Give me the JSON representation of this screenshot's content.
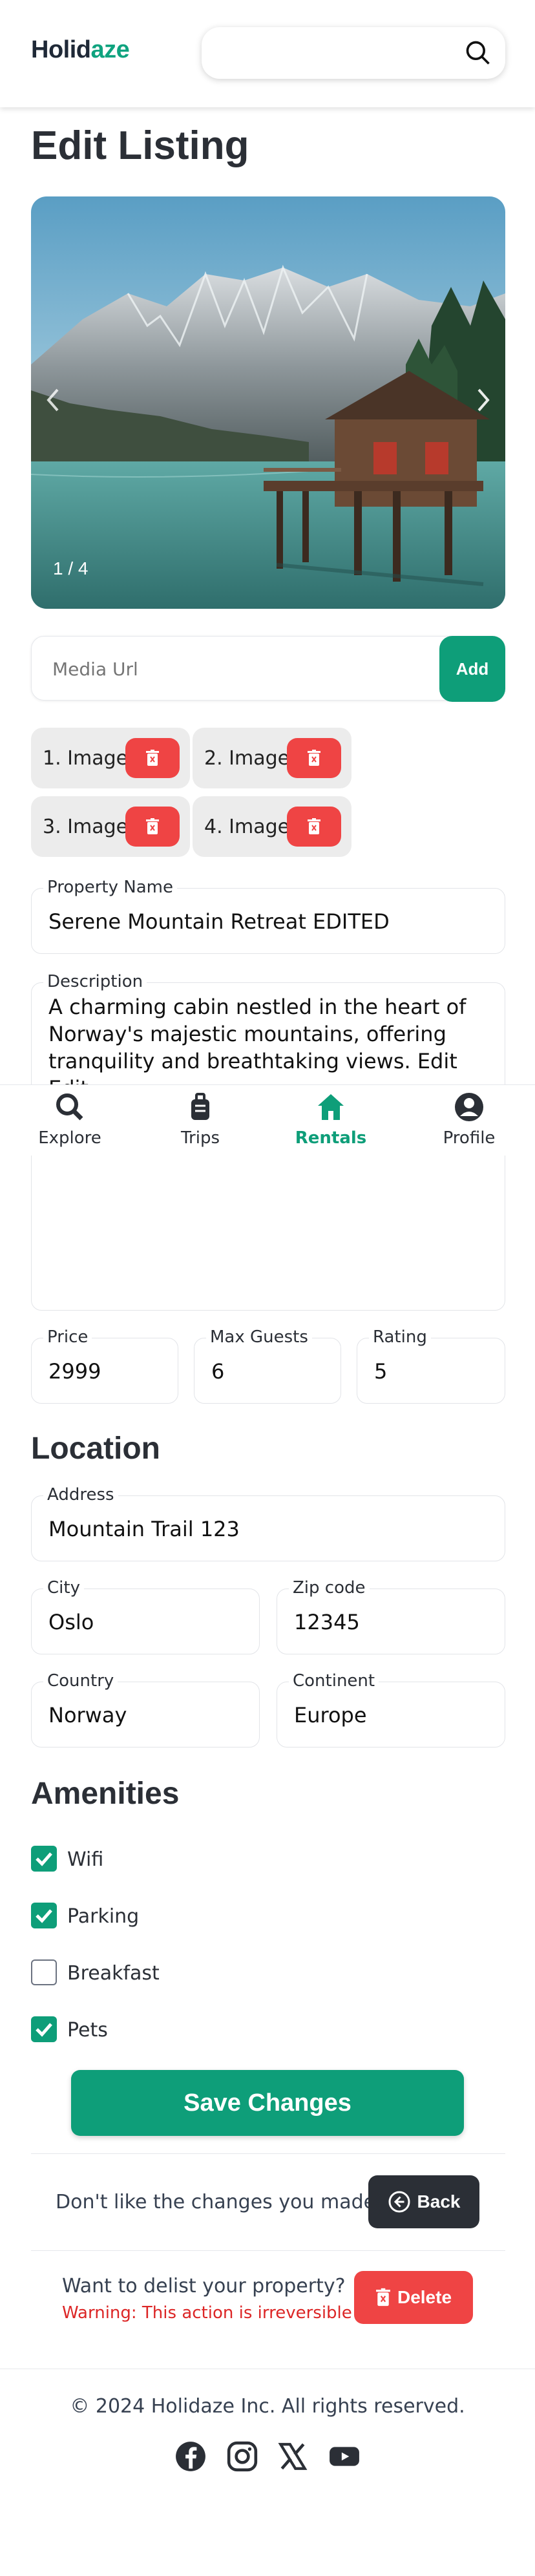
{
  "header": {
    "logo_main": "Holid",
    "logo_accent": "aze",
    "search_placeholder": "",
    "search_icon": "search-icon"
  },
  "page_title": "Edit Listing",
  "carousel": {
    "counter": "1 / 4",
    "prev_icon": "chevron-left-icon",
    "next_icon": "chevron-right-icon"
  },
  "media": {
    "placeholder": "Media Url",
    "add_label": "Add"
  },
  "images": [
    {
      "label": "1. Image"
    },
    {
      "label": "2. Image"
    },
    {
      "label": "3. Image"
    },
    {
      "label": "4. Image"
    }
  ],
  "form": {
    "property_name_label": "Property Name",
    "property_name": "Serene Mountain Retreat EDITED",
    "description_label": "Description",
    "description": "A charming cabin nestled in the heart of Norway's majestic mountains, offering tranquility and breathtaking views. Edit Edit",
    "price_label": "Price",
    "price": "2999",
    "max_guests_label": "Max Guests",
    "max_guests": "6",
    "rating_label": "Rating",
    "rating": "5"
  },
  "nav": [
    {
      "label": "Explore",
      "icon": "search-icon"
    },
    {
      "label": "Trips",
      "icon": "luggage-icon"
    },
    {
      "label": "Rentals",
      "icon": "home-icon",
      "active": true
    },
    {
      "label": "Profile",
      "icon": "user-circle-icon"
    }
  ],
  "location": {
    "heading": "Location",
    "address_label": "Address",
    "address": "Mountain Trail 123",
    "city_label": "City",
    "city": "Oslo",
    "zip_label": "Zip code",
    "zip": "12345",
    "country_label": "Country",
    "country": "Norway",
    "continent_label": "Continent",
    "continent": "Europe"
  },
  "amenities": {
    "heading": "Amenities",
    "items": [
      {
        "label": "Wifi",
        "checked": true
      },
      {
        "label": "Parking",
        "checked": true
      },
      {
        "label": "Breakfast",
        "checked": false
      },
      {
        "label": "Pets",
        "checked": true
      }
    ]
  },
  "actions": {
    "save_label": "Save Changes",
    "undo_prompt": "Don't like the changes you made?",
    "back_label": "Back",
    "delist_prompt": "Want to delist your property?",
    "delist_warning": "Warning: This action is irreversible",
    "delete_label": "Delete"
  },
  "footer": {
    "copyright": "© 2024 Holidaze Inc. All rights reserved.",
    "social": [
      "facebook-icon",
      "instagram-icon",
      "x-icon",
      "youtube-icon"
    ]
  },
  "colors": {
    "brand": "#0e9e79",
    "danger": "#ef4444",
    "dark": "#2b2f36"
  }
}
